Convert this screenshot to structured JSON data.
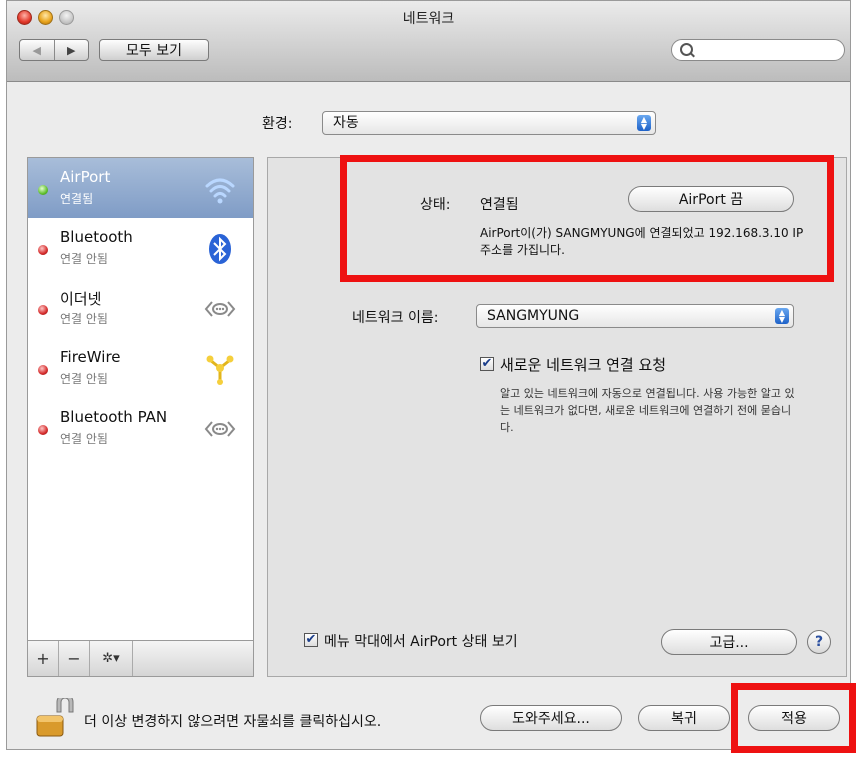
{
  "window": {
    "title": "네트워크",
    "nav_back": "◀",
    "nav_forward": "▶",
    "show_all": "모두 보기",
    "search_placeholder": ""
  },
  "location": {
    "label": "환경:",
    "value": "자동",
    "arrows": "▲▼"
  },
  "services": [
    {
      "name": "AirPort",
      "status": "연결됨",
      "dot": "green",
      "icon": "wifi-icon",
      "selected": true
    },
    {
      "name": "Bluetooth",
      "status": "연결 안됨",
      "dot": "red",
      "icon": "bluetooth-icon"
    },
    {
      "name": "이더넷",
      "status": "연결 안됨",
      "dot": "red",
      "icon": "ethernet-icon"
    },
    {
      "name": "FireWire",
      "status": "연결 안됨",
      "dot": "red",
      "icon": "firewire-icon"
    },
    {
      "name": "Bluetooth PAN",
      "status": "연결 안됨",
      "dot": "red",
      "icon": "ethernet-icon"
    }
  ],
  "sidebar_toolbar": {
    "add": "+",
    "remove": "−",
    "gear": "✲▾"
  },
  "detail": {
    "status_label": "상태:",
    "status_value": "연결됨",
    "airport_off_button": "AirPort 끔",
    "status_desc": "AirPort이(가) SANGMYUNG에 연결되었고 192.168.3.10 IP 주소를 가집니다.",
    "network_name_label": "네트워크 이름:",
    "network_name_value": "SANGMYUNG",
    "ask_join_checked": true,
    "ask_join_label": "새로운 네트워크 연결 요청",
    "ask_join_desc": "알고 있는 네트워크에 자동으로 연결됩니다. 사용 가능한 알고 있는 네트워크가 없다면, 새로운 네트워크에 연결하기 전에 묻습니다.",
    "menu_bar_checked": true,
    "menu_bar_label": "메뉴 막대에서 AirPort 상태 보기",
    "advanced_button": "고급...",
    "help_button": "?"
  },
  "footer": {
    "lock_text": "더 이상 변경하지 않으려면 자물쇠를 클릭하십시오.",
    "assist_button": "도와주세요...",
    "revert_button": "복귀",
    "apply_button": "적용"
  },
  "colors": {
    "highlight_box": "#ee1111",
    "selection": "#8fa9cf"
  }
}
